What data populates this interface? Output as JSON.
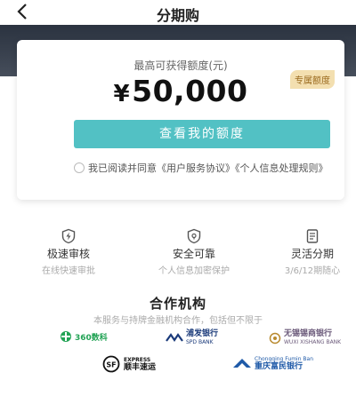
{
  "header": {
    "title": "分期购"
  },
  "card": {
    "limit_label": "最高可获得额度(元)",
    "currency": "¥",
    "amount": "50,000",
    "badge": "专属额度",
    "cta_label": "查看我的额度",
    "agree_prefix": "我已阅读并同意",
    "agreement_user": "《用户服务协议》",
    "agreement_privacy": "《个人信息处理规则》"
  },
  "features": [
    {
      "title": "极速审核",
      "desc": "在线快速审批",
      "icon": "lightning-shield-icon"
    },
    {
      "title": "安全可靠",
      "desc": "个人信息加密保护",
      "icon": "lock-shield-icon"
    },
    {
      "title": "灵活分期",
      "desc": "3/6/12期随心",
      "icon": "document-icon"
    }
  ],
  "partners": {
    "title": "合作机构",
    "subtitle": "本服务与持牌金融机构合作，包括但不限于",
    "logos": [
      {
        "name": "360数科",
        "icon": "360-logo-icon"
      },
      {
        "name": "浦发银行",
        "sub": "SPD BANK",
        "icon": "spd-bank-logo-icon"
      },
      {
        "name": "无锡锡商银行",
        "sub": "WUXI XISHANG BANK",
        "icon": "xishang-bank-logo-icon"
      },
      {
        "name": "顺丰速运",
        "sub": "EXPRESS",
        "icon": "sf-express-logo-icon"
      },
      {
        "name": "重庆富民银行",
        "sub": "Chongqing Fumin Ban",
        "icon": "fumin-bank-logo-icon"
      }
    ]
  },
  "colors": {
    "cta": "#52c1c4",
    "badge_bg": "#f3dfb0",
    "banner": "#39414e"
  }
}
